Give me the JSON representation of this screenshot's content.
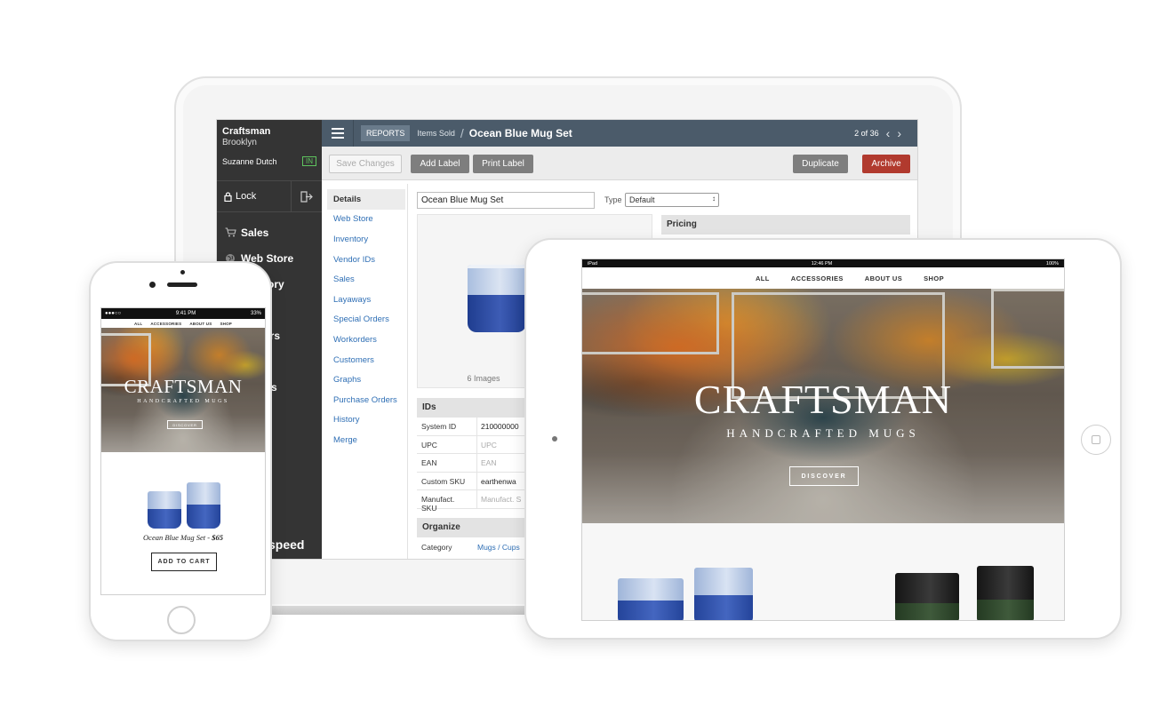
{
  "desktop": {
    "sidebar": {
      "store_name": "Craftsman",
      "store_location": "Brooklyn",
      "user_name": "Suzanne Dutch",
      "clock_status": "IN",
      "lock_label": "Lock",
      "nav": [
        {
          "label": "Sales",
          "icon": "cart-icon"
        },
        {
          "label": "Web Store",
          "icon": "globe-icon"
        },
        {
          "label": "ory",
          "icon": "box-icon"
        },
        {
          "label": "",
          "icon": "tag-icon"
        },
        {
          "label": "ers",
          "icon": "users-icon"
        },
        {
          "label": "",
          "icon": "chart-icon"
        },
        {
          "label": "s",
          "icon": "gear-icon"
        }
      ],
      "brand_fragment": "speed"
    },
    "topbar": {
      "reports_label": "REPORTS",
      "breadcrumb": "Items Sold",
      "separator": "/",
      "title": "Ocean Blue Mug Set",
      "pager": "2 of 36"
    },
    "actions": {
      "save": "Save Changes",
      "add_label": "Add Label",
      "print_label": "Print Label",
      "duplicate": "Duplicate",
      "archive": "Archive"
    },
    "subnav": [
      "Details",
      "Web Store",
      "Inventory",
      "Vendor IDs",
      "Sales",
      "Layaways",
      "Special Orders",
      "Workorders",
      "Customers",
      "Graphs",
      "Purchase Orders",
      "History",
      "Merge"
    ],
    "form": {
      "name_value": "Ocean Blue Mug Set",
      "type_label": "Type",
      "type_value": "Default",
      "image_caption": "6 Images",
      "pricing_header": "Pricing"
    },
    "ids": {
      "header": "IDs",
      "rows": [
        {
          "label": "System ID",
          "value": "210000000",
          "placeholder": false
        },
        {
          "label": "UPC",
          "value": "UPC",
          "placeholder": true
        },
        {
          "label": "EAN",
          "value": "EAN",
          "placeholder": true
        },
        {
          "label": "Custom SKU",
          "value": "earthenwa",
          "placeholder": false
        },
        {
          "label": "Manufact. SKU",
          "value": "Manufact. S",
          "placeholder": true
        }
      ]
    },
    "organize": {
      "header": "Organize",
      "category_label": "Category",
      "category_value": "Mugs / Cups"
    }
  },
  "phone": {
    "time": "9:41 PM",
    "battery": "33%",
    "signal": "●●●○○",
    "nav": [
      "ALL",
      "ACCESSORIES",
      "ABOUT US",
      "SHOP"
    ],
    "brand": "CRAFTSMAN",
    "subtitle": "HANDCRAFTED MUGS",
    "discover": "DISCOVER",
    "product_name": "Ocean Blue Mug Set -",
    "product_price": "$65",
    "cart": "ADD TO CART"
  },
  "tablet": {
    "device": "iPad",
    "time": "12:46 PM",
    "battery": "100%",
    "nav": [
      "ALL",
      "ACCESSORIES",
      "ABOUT US",
      "SHOP"
    ],
    "brand": "CRAFTSMAN",
    "subtitle": "HANDCRAFTED MUGS",
    "discover": "DISCOVER"
  },
  "colors": {
    "topbar": "#4b5b6a",
    "sidebar": "#343434",
    "archive": "#b13a2e",
    "link": "#2f6fb5",
    "mug_blue": "#2a4aa0",
    "mug_light": "#c9d6ec"
  }
}
